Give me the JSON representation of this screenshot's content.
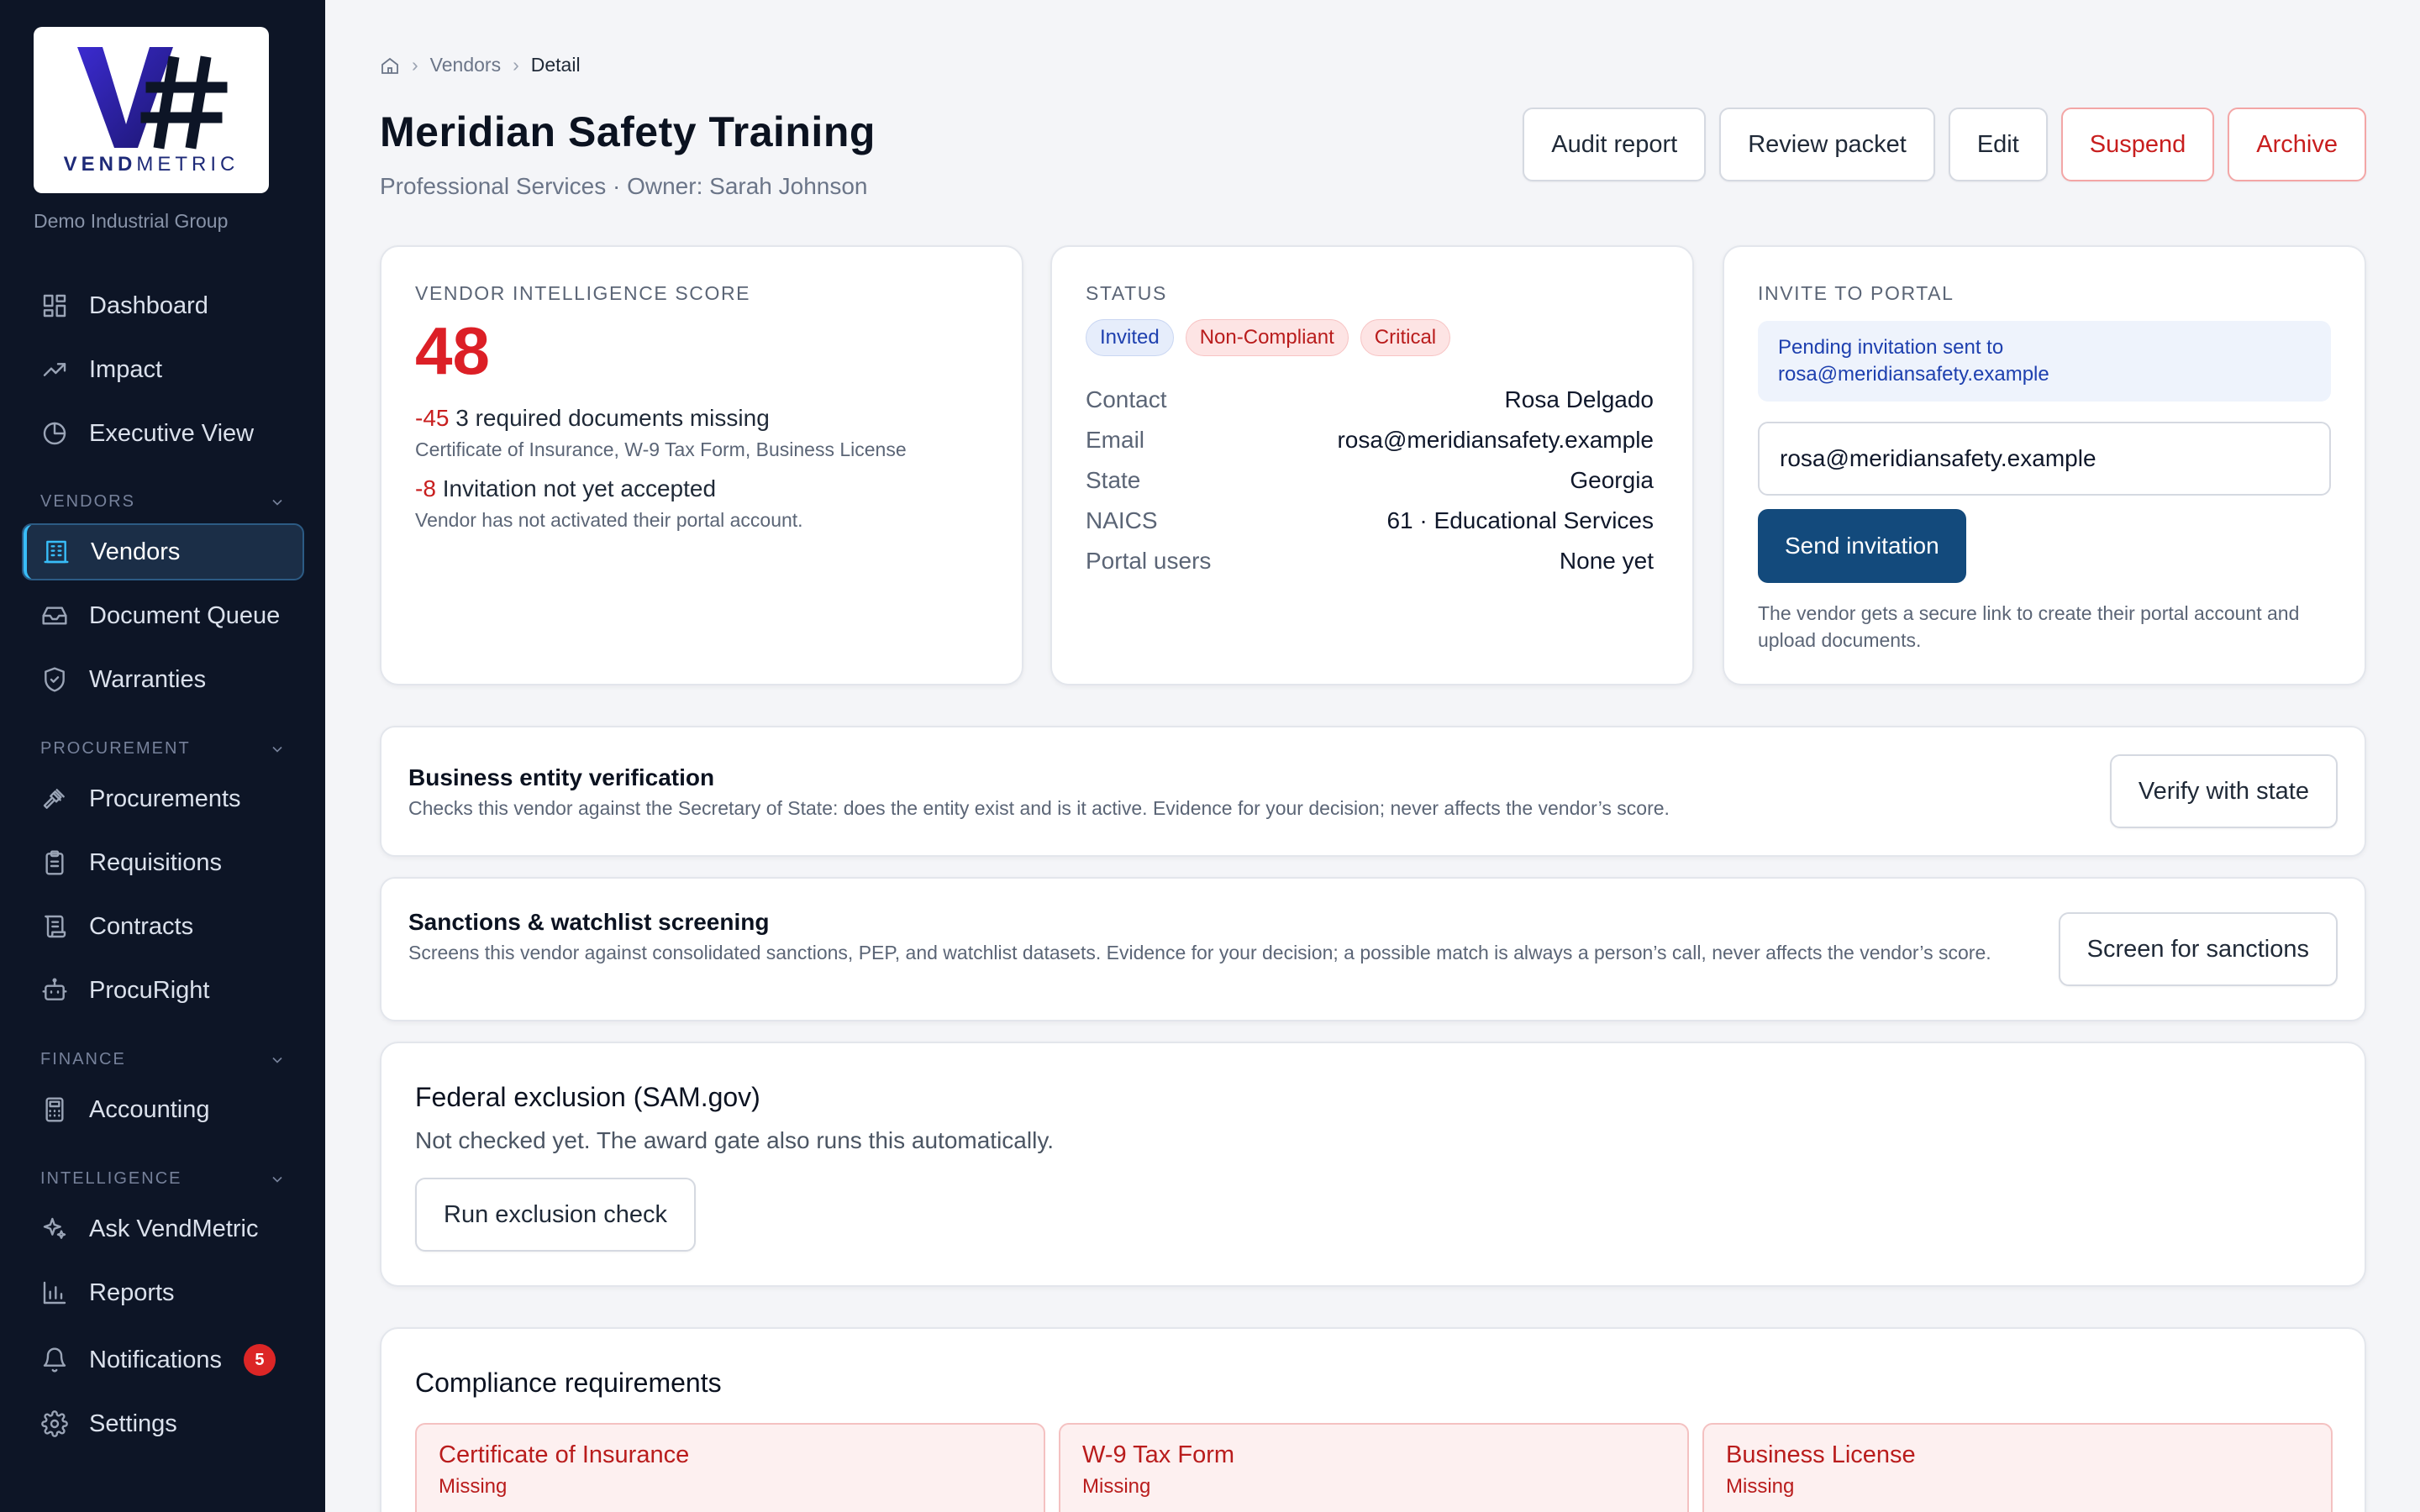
{
  "brand": {
    "logo_text_a": "VEND",
    "logo_text_b": "METRIC",
    "org": "Demo Industrial Group",
    "accent": "#2d1f8f"
  },
  "nav": {
    "top": [
      {
        "label": "Dashboard",
        "icon": "dashboard-icon"
      },
      {
        "label": "Impact",
        "icon": "trend-icon"
      },
      {
        "label": "Executive View",
        "icon": "pie-icon"
      }
    ],
    "sections": {
      "vendors": {
        "title": "VENDORS",
        "items": [
          {
            "label": "Vendors",
            "icon": "building-icon"
          },
          {
            "label": "Document Queue",
            "icon": "inbox-icon"
          },
          {
            "label": "Warranties",
            "icon": "shield-icon"
          }
        ]
      },
      "procurement": {
        "title": "PROCUREMENT",
        "items": [
          {
            "label": "Procurements",
            "icon": "gavel-icon"
          },
          {
            "label": "Requisitions",
            "icon": "clipboard-icon"
          },
          {
            "label": "Contracts",
            "icon": "scroll-icon"
          },
          {
            "label": "ProcuRight",
            "icon": "robot-icon"
          }
        ]
      },
      "finance": {
        "title": "FINANCE",
        "items": [
          {
            "label": "Accounting",
            "icon": "calculator-icon"
          }
        ]
      },
      "intelligence": {
        "title": "INTELLIGENCE",
        "items": [
          {
            "label": "Ask VendMetric",
            "icon": "sparkle-icon"
          },
          {
            "label": "Reports",
            "icon": "bar-chart-icon"
          },
          {
            "label": "Notifications",
            "icon": "bell-icon",
            "badge": "5"
          },
          {
            "label": "Settings",
            "icon": "gear-icon"
          }
        ]
      }
    }
  },
  "breadcrumb": {
    "items": [
      "Vendors",
      "Detail"
    ],
    "sep": "›"
  },
  "header": {
    "title": "Meridian Safety Training",
    "subtitle": "Professional Services · Owner: Sarah Johnson",
    "actions": [
      "Audit report",
      "Review packet",
      "Edit",
      "Suspend",
      "Archive"
    ]
  },
  "score": {
    "label": "VENDOR INTELLIGENCE SCORE",
    "value": "48",
    "deductions": [
      {
        "points": "-45",
        "text": "3 required documents missing",
        "note": "Certificate of Insurance, W-9 Tax Form, Business License"
      },
      {
        "points": "-8",
        "text": "Invitation not yet accepted",
        "note": "Vendor has not activated their portal account."
      }
    ]
  },
  "status": {
    "label": "STATUS",
    "pills": [
      "Invited",
      "Non-Compliant",
      "Critical"
    ],
    "fields": [
      {
        "k": "Contact",
        "v": "Rosa Delgado"
      },
      {
        "k": "Email",
        "v": "rosa@meridiansafety.example"
      },
      {
        "k": "State",
        "v": "Georgia"
      },
      {
        "k": "NAICS",
        "v": "61 · Educational Services"
      },
      {
        "k": "Portal users",
        "v": "None yet"
      }
    ]
  },
  "invite": {
    "label": "INVITE TO PORTAL",
    "notice_line1": "Pending invitation sent to",
    "notice_line2": "rosa@meridiansafety.example",
    "email_value": "rosa@meridiansafety.example",
    "send_label": "Send invitation",
    "help": "The vendor gets a secure link to create their portal account and upload documents."
  },
  "entity": {
    "title": "Business entity verification",
    "desc": "Checks this vendor against the Secretary of State: does the entity exist and is it active. Evidence for your decision; never affects the vendor’s score.",
    "button": "Verify with state"
  },
  "sanctions": {
    "title": "Sanctions & watchlist screening",
    "desc": "Screens this vendor against consolidated sanctions, PEP, and watchlist datasets. Evidence for your decision; a possible match is always a person’s call, never affects the vendor’s score.",
    "button": "Screen for sanctions"
  },
  "exclusion": {
    "title": "Federal exclusion (SAM.gov)",
    "desc": "Not checked yet. The award gate also runs this automatically.",
    "button": "Run exclusion check"
  },
  "compliance": {
    "title": "Compliance requirements",
    "items": [
      {
        "name": "Certificate of Insurance",
        "status": "Missing"
      },
      {
        "name": "W-9 Tax Form",
        "status": "Missing"
      },
      {
        "name": "Business License",
        "status": "Missing"
      }
    ]
  }
}
